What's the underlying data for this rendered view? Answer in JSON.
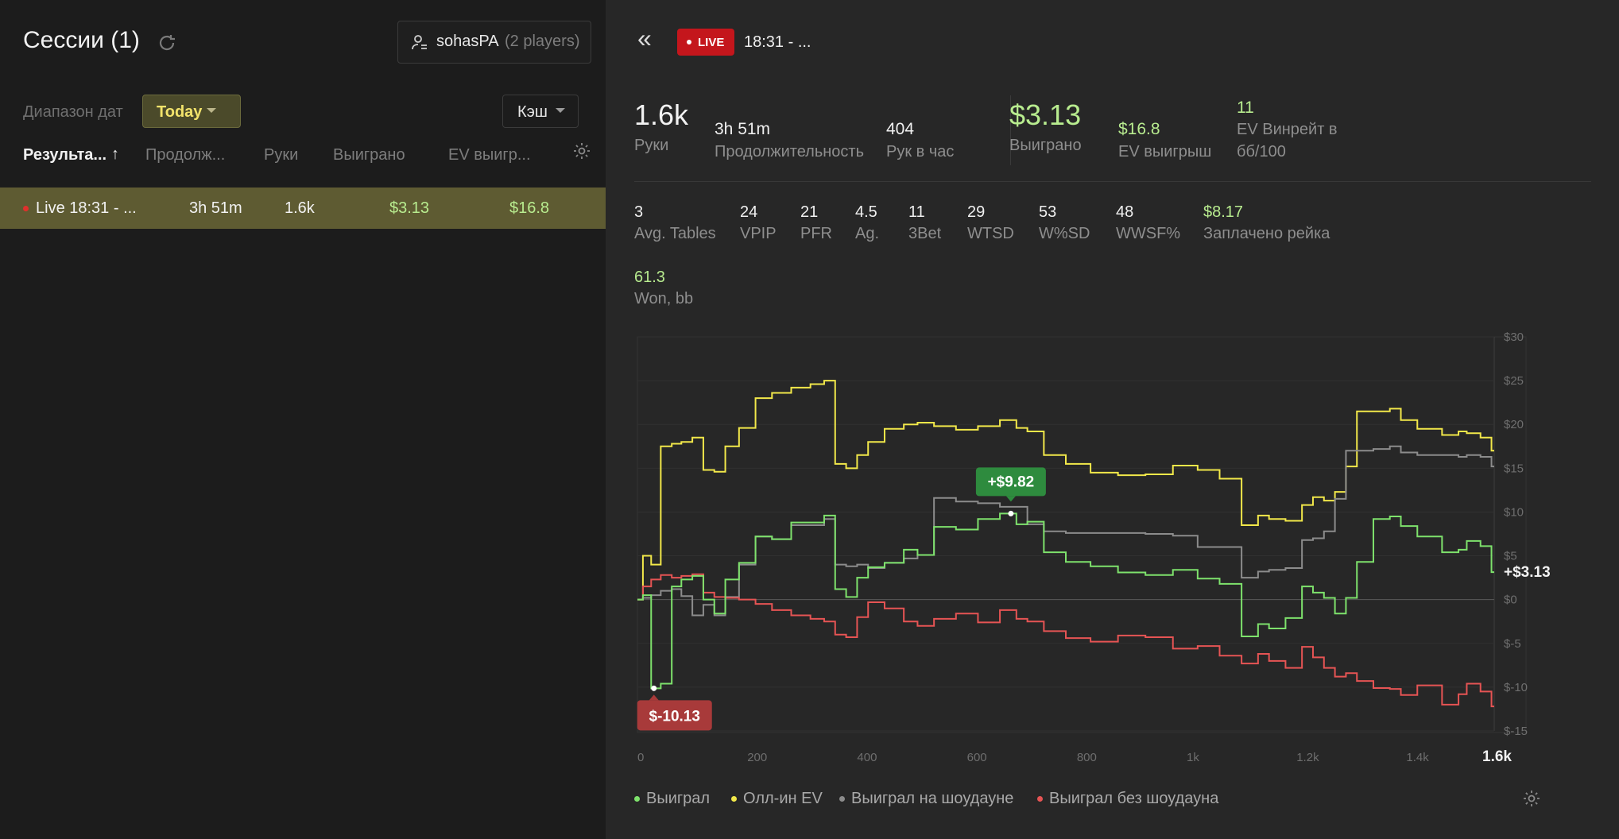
{
  "left": {
    "title": "Сессии (1)",
    "player_name": "sohasPA",
    "player_count": "(2 players)",
    "date_range_label": "Диапазон дат",
    "date_range_value": "Today",
    "game_type": "Кэш",
    "columns": [
      "Результа...",
      "Продолж...",
      "Руки",
      "Выиграно",
      "EV выигр..."
    ],
    "sort_arrow": "↑",
    "row": {
      "name": "Live 18:31 - ...",
      "duration": "3h 51m",
      "hands": "1.6k",
      "won": "$3.13",
      "ev": "$16.8"
    }
  },
  "header": {
    "back": "«",
    "live_badge": "LIVE",
    "session_title": "18:31 - ..."
  },
  "summary": {
    "hands_value": "1.6k",
    "hands_label": "Руки",
    "duration_value": "3h 51m",
    "duration_label": "Продолжительность",
    "hph_value": "404",
    "hph_label": "Рук в час",
    "won_value": "$3.13",
    "won_label": "Выиграно",
    "ev_value": "$16.8",
    "ev_label": "EV выигрыш",
    "evbb_value": "11",
    "evbb_label": "EV Винрейт в",
    "evbb_label2": "бб/100"
  },
  "stats": [
    {
      "value": "3",
      "label": "Avg. Tables"
    },
    {
      "value": "24",
      "label": "VPIP"
    },
    {
      "value": "21",
      "label": "PFR"
    },
    {
      "value": "4.5",
      "label": "Ag."
    },
    {
      "value": "11",
      "label": "3Bet"
    },
    {
      "value": "29",
      "label": "WTSD"
    },
    {
      "value": "53",
      "label": "W%SD"
    },
    {
      "value": "48",
      "label": "WWSF%"
    },
    {
      "value": "$8.17",
      "label": "Заплачено рейка"
    }
  ],
  "won_bb": {
    "value": "61.3",
    "label": "Won, bb"
  },
  "chart_data": {
    "type": "line",
    "x_ticks": [
      "0",
      "200",
      "400",
      "600",
      "800",
      "1k",
      "1.2k",
      "1.4k",
      "1.6k"
    ],
    "y_ticks": [
      "$30",
      "$25",
      "$20",
      "$15",
      "$10",
      "$5",
      "$0",
      "$-5",
      "$-10",
      "$-15"
    ],
    "xlim": [
      0,
      1560
    ],
    "ylim": [
      -15,
      30
    ],
    "annotations": {
      "max": "+$9.82",
      "min": "$-10.13",
      "end": "+$3.13"
    },
    "series": [
      {
        "name": "Выиграл",
        "color": "#7ee26c",
        "x": [
          0,
          20,
          30,
          55,
          70,
          90,
          110,
          130,
          150,
          170,
          200,
          230,
          260,
          300,
          330,
          350,
          370,
          390,
          410,
          430,
          470,
          500,
          520,
          560,
          600,
          640,
          680,
          700,
          720,
          760,
          800,
          850,
          900,
          950,
          1000,
          1040,
          1080,
          1120,
          1140,
          1160,
          1200,
          1220,
          1240,
          1260,
          1280,
          1300,
          1320,
          1360,
          1380,
          1400,
          1440,
          1490,
          1500,
          1520,
          1550,
          1560
        ],
        "y": [
          0,
          0.5,
          -10.13,
          -9.6,
          1.5,
          2.3,
          2.7,
          0,
          -1.6,
          2.3,
          4.2,
          7.2,
          6.9,
          8.8,
          8.8,
          9.6,
          1.2,
          0.3,
          2.5,
          3.7,
          4.2,
          5.7,
          5.1,
          8.3,
          8.0,
          9.2,
          9.82,
          8.6,
          8.9,
          5.4,
          4.3,
          3.8,
          3.1,
          2.8,
          3.4,
          2.4,
          1.8,
          -4.2,
          -2.8,
          -3.3,
          -2.1,
          1.5,
          0.8,
          0.2,
          -1.6,
          0.2,
          4.3,
          9.2,
          9.5,
          8.4,
          7.2,
          5.4,
          5.7,
          6.7,
          6.1,
          3.13
        ]
      },
      {
        "name": "Олл-ин EV",
        "color": "#f2e84a",
        "x": [
          0,
          20,
          30,
          55,
          70,
          90,
          110,
          130,
          150,
          170,
          200,
          230,
          260,
          300,
          330,
          350,
          370,
          390,
          410,
          430,
          470,
          500,
          520,
          560,
          600,
          640,
          680,
          700,
          720,
          760,
          800,
          850,
          900,
          950,
          1000,
          1040,
          1080,
          1120,
          1140,
          1160,
          1200,
          1220,
          1240,
          1260,
          1280,
          1300,
          1320,
          1360,
          1380,
          1400,
          1440,
          1490,
          1500,
          1520,
          1550,
          1560
        ],
        "y": [
          0,
          5,
          4,
          17.5,
          17.8,
          18.0,
          18.5,
          14.8,
          14.6,
          17.5,
          19.6,
          23.0,
          23.6,
          24.2,
          24.6,
          25.0,
          15.5,
          15.0,
          16.5,
          18.0,
          19.5,
          20.0,
          20.2,
          19.8,
          19.4,
          19.8,
          20.5,
          19.6,
          19.2,
          16.5,
          15.5,
          14.5,
          14.2,
          14.3,
          15.3,
          14.8,
          13.8,
          8.5,
          9.6,
          9.2,
          9.0,
          10.8,
          11.7,
          11.3,
          12.3,
          15.2,
          21.5,
          21.5,
          21.8,
          20.5,
          19.5,
          18.8,
          19.2,
          19.0,
          18.5,
          17.0
        ]
      },
      {
        "name": "Выиграл на шоудауне",
        "color": "#8c8c8c",
        "x": [
          0,
          20,
          30,
          55,
          70,
          90,
          110,
          130,
          150,
          170,
          200,
          230,
          260,
          300,
          330,
          350,
          370,
          390,
          410,
          430,
          470,
          500,
          520,
          560,
          600,
          640,
          680,
          700,
          720,
          760,
          800,
          850,
          900,
          950,
          1000,
          1040,
          1080,
          1120,
          1140,
          1160,
          1200,
          1220,
          1240,
          1260,
          1280,
          1300,
          1320,
          1360,
          1380,
          1400,
          1440,
          1490,
          1500,
          1520,
          1550,
          1560
        ],
        "y": [
          0,
          0.2,
          0.5,
          1.0,
          1.2,
          0.4,
          -1.8,
          -0.6,
          -1.8,
          0.3,
          4.0,
          7.2,
          6.9,
          8.5,
          8.5,
          9.2,
          4.0,
          3.8,
          4.0,
          3.6,
          4.2,
          4.7,
          5.1,
          11.6,
          11.2,
          11.0,
          10.6,
          10.6,
          8.6,
          7.8,
          7.6,
          7.6,
          7.6,
          7.5,
          7.3,
          6.0,
          6.0,
          2.5,
          3.2,
          3.4,
          3.6,
          6.8,
          7.0,
          7.8,
          11.5,
          17.0,
          17.0,
          17.2,
          17.5,
          16.8,
          16.5,
          16.5,
          16.3,
          16.5,
          16.3,
          15.2
        ]
      },
      {
        "name": "Выиграл без шоудауна",
        "color": "#e65454",
        "x": [
          0,
          20,
          30,
          55,
          70,
          90,
          110,
          130,
          150,
          170,
          200,
          230,
          260,
          300,
          330,
          350,
          370,
          390,
          410,
          430,
          470,
          500,
          520,
          560,
          600,
          640,
          680,
          700,
          720,
          760,
          800,
          850,
          900,
          950,
          1000,
          1040,
          1080,
          1120,
          1140,
          1160,
          1200,
          1220,
          1240,
          1260,
          1280,
          1300,
          1320,
          1360,
          1380,
          1400,
          1440,
          1490,
          1500,
          1520,
          1550,
          1560
        ],
        "y": [
          0,
          1.5,
          2.3,
          2.8,
          2.5,
          2.7,
          2.9,
          0.8,
          0.3,
          0.2,
          0.0,
          -0.5,
          -1.2,
          -1.8,
          -2.2,
          -2.5,
          -4.0,
          -4.3,
          -2.0,
          -0.3,
          -1.0,
          -2.5,
          -3.0,
          -2.2,
          -1.6,
          -2.6,
          -1.2,
          -2.2,
          -2.5,
          -3.6,
          -4.4,
          -4.8,
          -4.1,
          -4.3,
          -5.6,
          -5.3,
          -6.4,
          -7.3,
          -6.2,
          -7.0,
          -7.8,
          -5.4,
          -6.6,
          -7.8,
          -8.8,
          -8.4,
          -9.3,
          -10.1,
          -10.2,
          -10.9,
          -9.8,
          -12.0,
          -10.8,
          -9.6,
          -10.5,
          -12.2
        ]
      }
    ]
  },
  "legend": [
    "Выиграл",
    "Олл-ин EV",
    "Выиграл на шоудауне",
    "Выиграл без шоудауна"
  ]
}
